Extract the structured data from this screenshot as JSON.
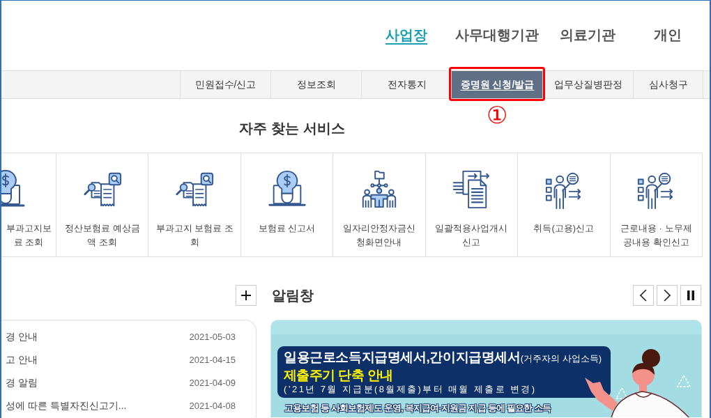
{
  "top_nav": [
    {
      "label": "사업장",
      "selected": true
    },
    {
      "label": "사무대행기관",
      "selected": false
    },
    {
      "label": "의료기관",
      "selected": false
    },
    {
      "label": "개인",
      "selected": false
    }
  ],
  "sub_nav": [
    {
      "label": "민원접수/신고",
      "selected": false,
      "highlighted": false
    },
    {
      "label": "정보조회",
      "selected": false,
      "highlighted": false
    },
    {
      "label": "전자통지",
      "selected": false,
      "highlighted": false
    },
    {
      "label": "증명원 신청/발급",
      "selected": true,
      "highlighted": true
    },
    {
      "label": "업무상질병판정",
      "selected": false,
      "highlighted": false
    },
    {
      "label": "심사청구",
      "selected": false,
      "highlighted": false
    }
  ],
  "callout": {
    "label": "①"
  },
  "services": {
    "title": "자주 찾는 서비스",
    "items": [
      {
        "lines": [
          "부과고지보",
          "료 조회"
        ],
        "kind": "bulb",
        "partial": true
      },
      {
        "lines": [
          "정산보험료 예상금",
          "액 조회"
        ],
        "kind": "document_search",
        "partial": false
      },
      {
        "lines": [
          "부과고지 보험료 조",
          "회"
        ],
        "kind": "document_search",
        "partial": false
      },
      {
        "lines": [
          "보험료 신고서"
        ],
        "kind": "bulb",
        "partial": false
      },
      {
        "lines": [
          "일자리안정자금신",
          "청화면안내"
        ],
        "kind": "team",
        "partial": false
      },
      {
        "lines": [
          "일괄적용사업개시",
          "신고"
        ],
        "kind": "document_arrows",
        "partial": false
      },
      {
        "lines": [
          "취득(고용)신고"
        ],
        "kind": "presenter",
        "partial": false
      },
      {
        "lines": [
          "근로내용 · 노무제",
          "공내용 확인신고"
        ],
        "kind": "presenter",
        "partial": false
      }
    ]
  },
  "notices": [
    {
      "title": "경 안내",
      "date": "2021-05-03"
    },
    {
      "title": "고 안내",
      "date": "2021-04-15"
    },
    {
      "title": "경 알림",
      "date": "2021-04-09"
    },
    {
      "title": "성에 따른 특별자진신고기...",
      "date": "2021-04-08"
    }
  ],
  "notice_board": {
    "title": "알림창",
    "banner": {
      "headline": "일용근로소득지급명세서,간이지급명세서",
      "headline_note": "(거주자의 사업소득)",
      "subtitle": "제출주기 단축 안내",
      "period": "(’21년 7월 지급분(8월제출)부터 매월 제출로 변경)",
      "body": "고용보험 등 사회보험제도 운영, 복지급여·지원금 지급 등에 필요한 소득"
    }
  }
}
